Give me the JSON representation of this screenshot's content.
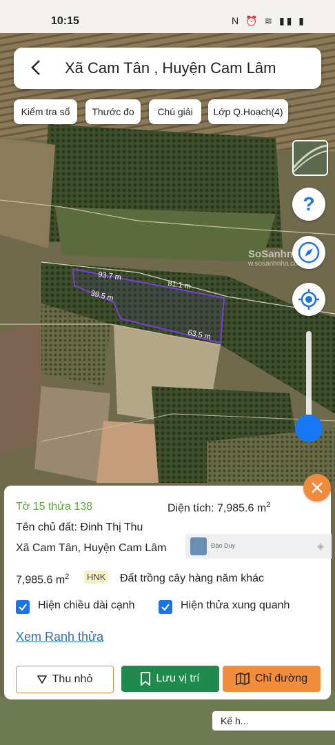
{
  "status": {
    "time": "10:15",
    "icons_text": "N ⏰ ≋ ▮▮ ▮"
  },
  "header": {
    "title": "Xã Cam Tân , Huyện Cam Lâm"
  },
  "chips": [
    "Kiểm tra sổ",
    "Thước đo",
    "Chú giải",
    "Lớp Q.Hoạch(4)"
  ],
  "map": {
    "edges": [
      "93.7 m",
      "81.1 m",
      "39.5 m",
      "63.5 m"
    ],
    "watermark": "SoSanhnha.co",
    "watermark_sub": "w.sosanhnha.com",
    "accent": "#7a3fd9"
  },
  "sheet": {
    "parcel_id": "Tờ 15 thửa 138",
    "area_label": "Diện tích: 7,985.6 m",
    "area_sup": "2",
    "owner": "Tên chủ đất: Đinh Thị Thu",
    "address": "Xã Cam Tân, Huyện Cam Lâm",
    "ad_name": "Đào Duy",
    "area_value": "7,985.6 m",
    "area_value_sup": "2",
    "land_code": "HNK",
    "land_type": "Đất trồng cây hàng năm khác",
    "cb_edges_label": "Hiện chiều dài cạnh",
    "cb_nearby_label": "Hiện thửa xung quanh",
    "link_label": "Xem Ranh thửa",
    "btn_collapse": "Thu nhỏ",
    "btn_save": "Lưu vị trí",
    "btn_route": "Chỉ đường"
  },
  "toast": {
    "text": "Kế h..."
  },
  "colors": {
    "green": "#1f8a4c",
    "orange": "#f28d3c",
    "blue": "#1a73e8"
  }
}
